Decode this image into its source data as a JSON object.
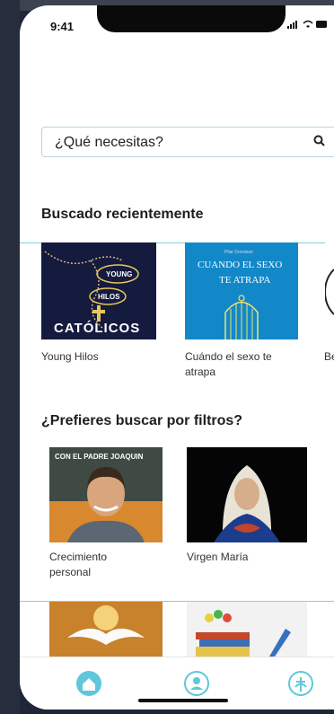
{
  "status_bar": {
    "time": "9:41",
    "signal_icon": "signal-icon",
    "wifi_icon": "wifi-icon"
  },
  "search": {
    "placeholder": "¿Qué necesitas?",
    "icon": "search-icon"
  },
  "recent": {
    "title": "Buscado recientemente",
    "items": [
      {
        "label": "Young Hilos",
        "cover_words": [
          "YOUNG",
          "HILOS",
          "CATÓLICOS"
        ]
      },
      {
        "label": "Cuándo el sexo te atrapa",
        "cover_top": "Pilar Donoban",
        "cover_words": [
          "CUANDO EL SEXO",
          "TE ATRAPA"
        ]
      },
      {
        "label": "Be"
      }
    ]
  },
  "filters": {
    "title": "¿Prefieres buscar por filtros?",
    "items": [
      {
        "label": "Crecimiento personal",
        "cover_top": "CON EL PADRE JOAQUIN"
      },
      {
        "label": "Virgen María"
      }
    ]
  },
  "tabbar": {
    "home_icon": "home-icon",
    "profile_icon": "profile-icon",
    "faith_icon": "faith-icon"
  }
}
